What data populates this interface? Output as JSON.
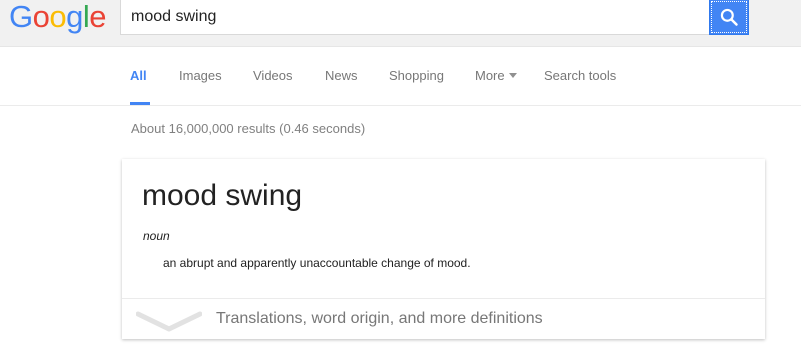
{
  "header": {
    "logo": {
      "letters": [
        "G",
        "o",
        "o",
        "g",
        "l",
        "e"
      ],
      "colors": [
        "#4285f4",
        "#ea4335",
        "#fbbc05",
        "#4285f4",
        "#34a853",
        "#ea4335"
      ]
    },
    "search": {
      "value": "mood swing",
      "button_icon": "search-icon",
      "button_color": "#4285f4"
    }
  },
  "tabs": [
    {
      "label": "All",
      "active": true
    },
    {
      "label": "Images"
    },
    {
      "label": "Videos"
    },
    {
      "label": "News"
    },
    {
      "label": "Shopping"
    },
    {
      "label": "More",
      "icon": "caret-down-icon"
    },
    {
      "label": "Search tools"
    }
  ],
  "results": {
    "stats": "About 16,000,000 results (0.46 seconds)"
  },
  "definition_card": {
    "term": "mood swing",
    "part_of_speech": "noun",
    "definition": "an abrupt and apparently unaccountable change of mood.",
    "expand_icon": "chevron-down-icon",
    "more_label": "Translations, word origin, and more definitions"
  }
}
